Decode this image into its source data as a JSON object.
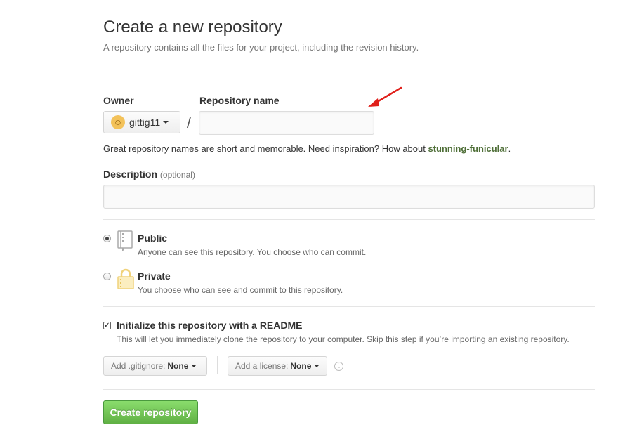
{
  "header": {
    "title": "Create a new repository",
    "subtitle": "A repository contains all the files for your project, including the revision history."
  },
  "owner": {
    "label": "Owner",
    "value": "gittig11",
    "avatar_icon": "user-avatar-icon"
  },
  "repo_name": {
    "label": "Repository name",
    "value": "",
    "separator": "/"
  },
  "name_hint": {
    "prefix": "Great repository names are short and memorable. Need inspiration? How about ",
    "suggestion": "stunning-funicular",
    "suffix": "."
  },
  "description": {
    "label": "Description",
    "optional": "(optional)",
    "value": ""
  },
  "visibility": {
    "selected": "public",
    "public": {
      "title": "Public",
      "desc": "Anyone can see this repository. You choose who can commit.",
      "icon": "repo-book-icon"
    },
    "private": {
      "title": "Private",
      "desc": "You choose who can see and commit to this repository.",
      "icon": "lock-icon"
    }
  },
  "readme": {
    "checked": true,
    "title": "Initialize this repository with a README",
    "desc": "This will let you immediately clone the repository to your computer. Skip this step if you’re importing an existing repository."
  },
  "gitignore": {
    "label": "Add .gitignore:",
    "value": "None"
  },
  "license": {
    "label": "Add a license:",
    "value": "None"
  },
  "submit": {
    "label": "Create repository"
  },
  "colors": {
    "accent_green": "#60b044",
    "suggestion_green": "#4e6e37",
    "annotation_arrow": "#e0201b"
  }
}
